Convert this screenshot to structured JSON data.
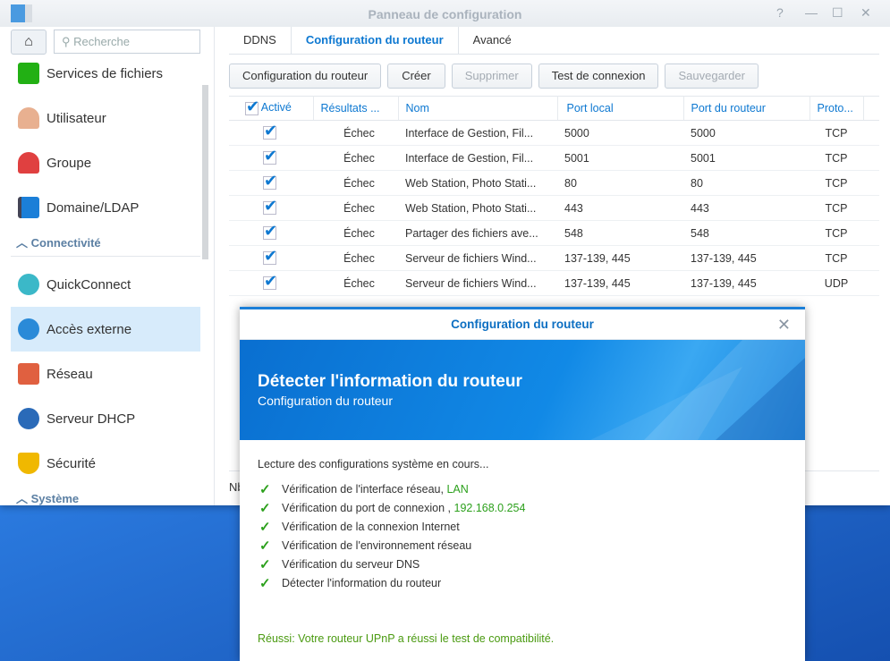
{
  "window": {
    "title": "Panneau de configuration",
    "help": "?",
    "minimize": "—",
    "maximize": "☐",
    "close": "✕"
  },
  "sidebar": {
    "search_placeholder": "Recherche",
    "items": [
      {
        "label": "Services de fichiers",
        "color": "#22b014"
      },
      {
        "label": "Utilisateur",
        "color": "#e8a070"
      },
      {
        "label": "Groupe",
        "color": "#e04040"
      },
      {
        "label": "Domaine/LDAP",
        "color": "#1b7fd8"
      },
      {
        "label": "QuickConnect",
        "color": "#3bb8c8"
      },
      {
        "label": "Accès externe",
        "color": "#2a8ad8"
      },
      {
        "label": "Réseau",
        "color": "#e06040"
      },
      {
        "label": "Serveur DHCP",
        "color": "#2a6ab8"
      },
      {
        "label": "Sécurité",
        "color": "#f0b800"
      }
    ],
    "sections": {
      "connectivity": "Connectivité",
      "system": "Système"
    }
  },
  "tabs": [
    {
      "label": "DDNS"
    },
    {
      "label": "Configuration du routeur",
      "active": true
    },
    {
      "label": "Avancé"
    }
  ],
  "toolbar": {
    "router_config": "Configuration du routeur",
    "create": "Créer",
    "delete": "Supprimer",
    "test": "Test de connexion",
    "save": "Sauvegarder"
  },
  "table": {
    "headers": [
      "Activé",
      "Résultats ...",
      "Nom",
      "Port local",
      "Port du routeur",
      "Proto..."
    ],
    "rows": [
      [
        "Échec",
        "Interface de Gestion, Fil...",
        "5000",
        "5000",
        "TCP"
      ],
      [
        "Échec",
        "Interface de Gestion, Fil...",
        "5001",
        "5001",
        "TCP"
      ],
      [
        "Échec",
        "Web Station, Photo Stati...",
        "80",
        "80",
        "TCP"
      ],
      [
        "Échec",
        "Web Station, Photo Stati...",
        "443",
        "443",
        "TCP"
      ],
      [
        "Échec",
        "Partager des fichiers ave...",
        "548",
        "548",
        "TCP"
      ],
      [
        "Échec",
        "Serveur de fichiers Wind...",
        "137-139, 445",
        "137-139, 445",
        "TCP"
      ],
      [
        "Échec",
        "Serveur de fichiers Wind...",
        "137-139, 445",
        "137-139, 445",
        "UDP"
      ]
    ]
  },
  "footer": {
    "partial_text": "Nb"
  },
  "dialog": {
    "title": "Configuration du routeur",
    "close": "✕",
    "banner_title": "Détecter l'information du routeur",
    "banner_subtitle": "Configuration du routeur",
    "intro": "Lecture des configurations système en cours...",
    "checks": [
      {
        "text": "Vérification de l'interface réseau,",
        "value": " LAN"
      },
      {
        "text": "Vérification du port de connexion ,",
        "value": " 192.168.0.254"
      },
      {
        "text": "Vérification de la connexion Internet",
        "value": ""
      },
      {
        "text": "Vérification de l'environnement réseau",
        "value": ""
      },
      {
        "text": "Vérification du serveur DNS",
        "value": ""
      },
      {
        "text": "Détecter l'information du routeur",
        "value": ""
      }
    ],
    "success": "Réussi: Votre routeur UPnP a réussi le test de compatibilité."
  }
}
